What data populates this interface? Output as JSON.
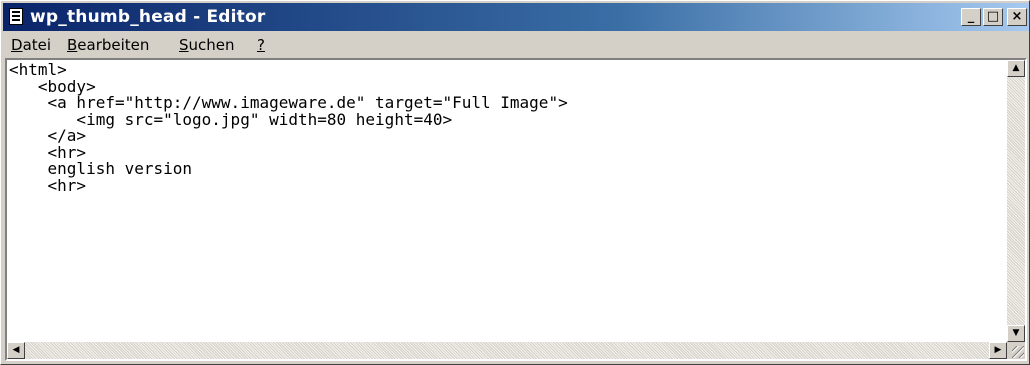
{
  "window": {
    "title": "wp_thumb_head - Editor",
    "buttons": {
      "minimize": "_",
      "maximize": "□",
      "close": "×"
    }
  },
  "menu": {
    "items": [
      {
        "label": "Datei",
        "mnemonic": "D"
      },
      {
        "label": "Bearbeiten",
        "mnemonic": "B"
      },
      {
        "label": "Suchen",
        "mnemonic": "S"
      },
      {
        "label": "?",
        "mnemonic": "?"
      }
    ]
  },
  "editor": {
    "content": "<html>\n   <body>\n    <a href=\"http://www.imageware.de\" target=\"Full Image\">\n       <img src=\"logo.jpg\" width=80 height=40>\n    </a>\n    <hr>\n    english version\n    <hr>"
  },
  "scrollbars": {
    "up_arrow": "▲",
    "down_arrow": "▼",
    "left_arrow": "◀",
    "right_arrow": "▶"
  },
  "colors": {
    "titlebar_start": "#0a246a",
    "titlebar_end": "#a6caf0",
    "window_face": "#d4d0c8"
  }
}
